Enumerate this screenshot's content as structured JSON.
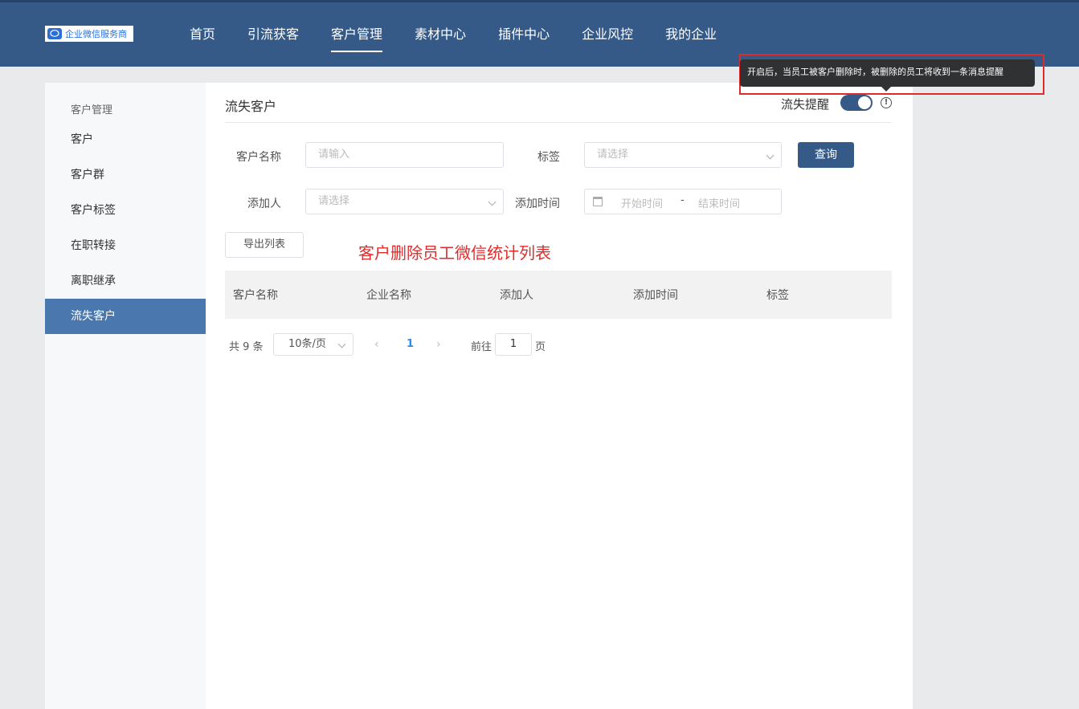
{
  "app": {
    "logo_text": "企业微信服务商"
  },
  "nav": {
    "items": [
      {
        "label": "首页"
      },
      {
        "label": "引流获客"
      },
      {
        "label": "客户管理"
      },
      {
        "label": "素材中心"
      },
      {
        "label": "插件中心"
      },
      {
        "label": "企业风控"
      },
      {
        "label": "我的企业"
      }
    ],
    "active_index": 2
  },
  "sidebar": {
    "title": "客户管理",
    "items": [
      {
        "label": "客户"
      },
      {
        "label": "客户群"
      },
      {
        "label": "客户标签"
      },
      {
        "label": "在职转接"
      },
      {
        "label": "离职继承"
      },
      {
        "label": "流失客户"
      }
    ],
    "active_index": 5
  },
  "page": {
    "title": "流失客户",
    "switch_label": "流失提醒",
    "switch_on": true,
    "tooltip": "开启后，当员工被客户删除时，被删除的员工将收到一条消息提醒"
  },
  "filters": {
    "customer_name_label": "客户名称",
    "customer_name_placeholder": "请输入",
    "tag_label": "标签",
    "tag_placeholder": "请选择",
    "adder_label": "添加人",
    "adder_placeholder": "请选择",
    "add_time_label": "添加时间",
    "start_placeholder": "开始时间",
    "range_separator": "-",
    "end_placeholder": "结束时间",
    "search_button": "查询"
  },
  "export_button": "导出列表",
  "annotation": "客户删除员工微信统计列表",
  "table": {
    "columns": [
      "客户名称",
      "企业名称",
      "添加人",
      "添加时间",
      "标签"
    ]
  },
  "pagination": {
    "total_text": "共 9 条",
    "page_size": "10条/页",
    "current_page": "1",
    "goto_label": "前往",
    "goto_value": "1",
    "page_suffix": "页"
  }
}
